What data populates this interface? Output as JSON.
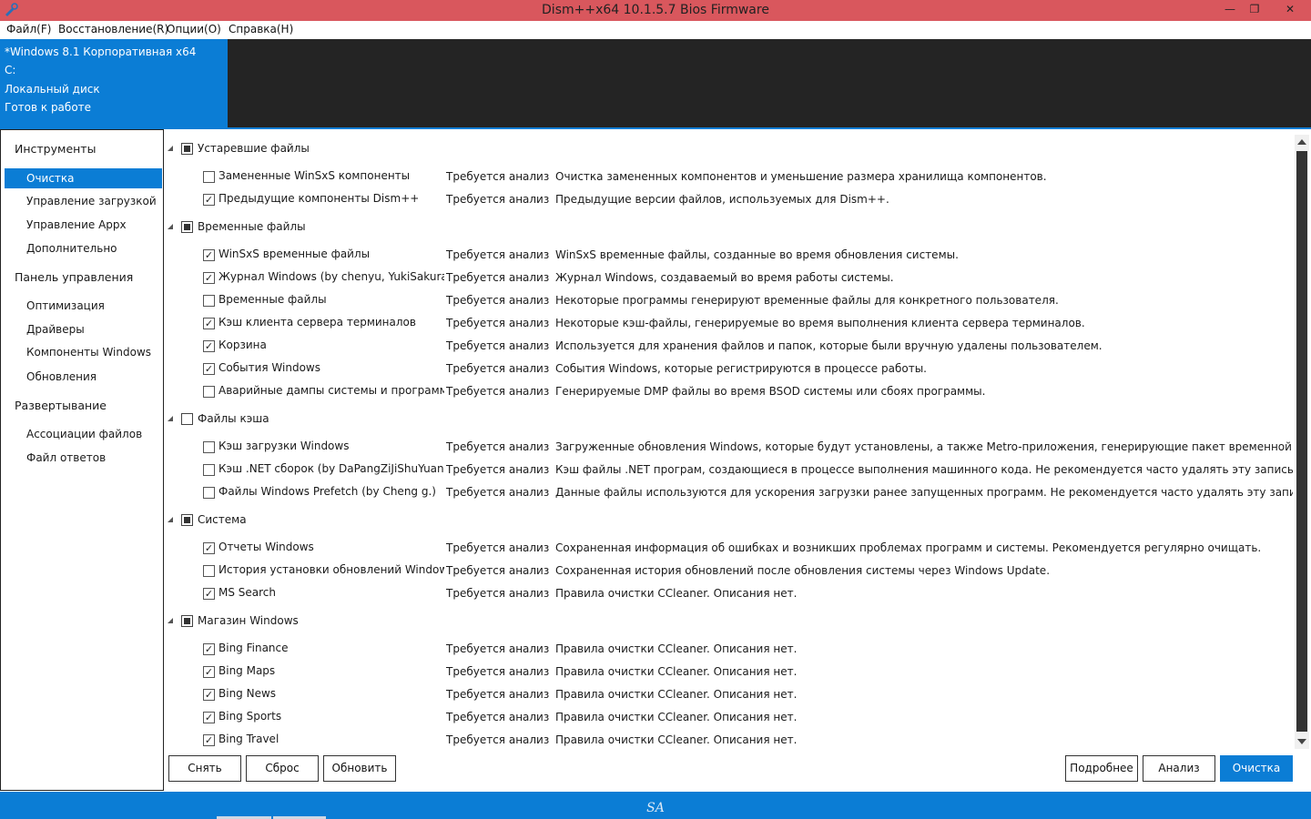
{
  "window": {
    "title": "Dism++x64 10.1.5.7 Bios Firmware",
    "minimize": "—",
    "maximize": "❐",
    "close": "✕"
  },
  "menu": [
    "Файл(F)",
    "Восстановление(R)",
    "Опции(O)",
    "Справка(H)"
  ],
  "info": {
    "os": "*Windows 8.1 Корпоративная x64",
    "drive": "C:",
    "disk": "Локальный диск",
    "state": "Готов к работе"
  },
  "sidebar": {
    "sections": [
      {
        "title": "Инструменты",
        "items": [
          "Очистка",
          "Управление загрузкой",
          "Управление Appx",
          "Дополнительно"
        ]
      },
      {
        "title": "Панель управления",
        "items": [
          "Оптимизация",
          "Драйверы",
          "Компоненты Windows",
          "Обновления"
        ]
      },
      {
        "title": "Развертывание",
        "items": [
          "Ассоциации файлов",
          "Файл ответов"
        ]
      }
    ],
    "active": "Очистка"
  },
  "groups": [
    {
      "label": "Устаревшие файлы",
      "state": "partial",
      "rows": [
        {
          "name": "Замененные WinSxS компоненты",
          "checked": false,
          "status": "Требуется анализ",
          "desc": "Очистка замененных компонентов и уменьшение размера хранилища компонентов."
        },
        {
          "name": "Предыдущие компоненты Dism++",
          "checked": true,
          "status": "Требуется анализ",
          "desc": "Предыдущие версии файлов, используемых для Dism++."
        }
      ]
    },
    {
      "label": "Временные файлы",
      "state": "partial",
      "rows": [
        {
          "name": "WinSxS временные файлы",
          "checked": true,
          "status": "Требуется анализ",
          "desc": "WinSxS временные файлы, созданные во время обновления системы."
        },
        {
          "name": "Журнал Windows (by chenyu, YukiSakura)",
          "checked": true,
          "status": "Требуется анализ",
          "desc": "Журнал Windows, создаваемый во время работы системы."
        },
        {
          "name": "Временные файлы",
          "checked": false,
          "status": "Требуется анализ",
          "desc": "Некоторые программы генерируют временные файлы для конкретного пользователя."
        },
        {
          "name": "Кэш клиента сервера терминалов",
          "checked": true,
          "status": "Требуется анализ",
          "desc": "Некоторые кэш-файлы, генерируемые во время выполнения клиента сервера терминалов."
        },
        {
          "name": "Корзина",
          "checked": true,
          "status": "Требуется анализ",
          "desc": "Используется для хранения файлов и папок, которые были вручную удалены пользователем."
        },
        {
          "name": "События Windows",
          "checked": true,
          "status": "Требуется анализ",
          "desc": "События Windows, которые регистрируются в процессе работы."
        },
        {
          "name": "Аварийные дампы системы и программ (b",
          "checked": false,
          "status": "Требуется анализ",
          "desc": "Генерируемые DMP файлы во время BSOD системы или сбоях программы."
        }
      ]
    },
    {
      "label": "Файлы кэша",
      "state": "unchecked",
      "rows": [
        {
          "name": "Кэш загрузки Windows",
          "checked": false,
          "status": "Требуется анализ",
          "desc": "Загруженные обновления Windows, которые будут установлены, а также Metro-приложения, генерирующие пакет временной установки"
        },
        {
          "name": "Кэш .NET сборок (by DaPangZiJiShuYuan)",
          "checked": false,
          "status": "Требуется анализ",
          "desc": "Кэш файлы .NET програм, создающиеся в процессе выполнения машинного кода. Не рекомендуется часто удалять эту запись."
        },
        {
          "name": "Файлы Windows Prefetch (by Cheng g.)",
          "checked": false,
          "status": "Требуется анализ",
          "desc": "Данные файлы используются для ускорения загрузки ранее запущенных программ. Не рекомендуется часто удалять эту запись."
        }
      ]
    },
    {
      "label": "Система",
      "state": "partial",
      "rows": [
        {
          "name": "Отчеты Windows",
          "checked": true,
          "status": "Требуется анализ",
          "desc": "Сохраненная информация об ошибках и возникших проблемах программ и системы. Рекомендуется регулярно очищать."
        },
        {
          "name": "История установки обновлений Windows",
          "checked": false,
          "status": "Требуется анализ",
          "desc": "Сохраненная история обновлений после обновления системы через Windows Update."
        },
        {
          "name": "MS Search",
          "checked": true,
          "status": "Требуется анализ",
          "desc": "Правила очистки CCleaner. Описания нет."
        }
      ]
    },
    {
      "label": "Магазин Windows",
      "state": "partial",
      "rows": [
        {
          "name": "Bing Finance",
          "checked": true,
          "status": "Требуется анализ",
          "desc": "Правила очистки CCleaner. Описания нет."
        },
        {
          "name": "Bing Maps",
          "checked": true,
          "status": "Требуется анализ",
          "desc": "Правила очистки CCleaner. Описания нет."
        },
        {
          "name": "Bing News",
          "checked": true,
          "status": "Требуется анализ",
          "desc": "Правила очистки CCleaner. Описания нет."
        },
        {
          "name": "Bing Sports",
          "checked": true,
          "status": "Требуется анализ",
          "desc": "Правила очистки CCleaner. Описания нет."
        },
        {
          "name": "Bing Travel",
          "checked": true,
          "status": "Требуется анализ",
          "desc": "Правила очистки CCleaner. Описания нет."
        }
      ]
    }
  ],
  "buttons": {
    "uncheck": "Снять",
    "reset": "Сброс",
    "refresh": "Обновить",
    "details": "Подробнее",
    "analyze": "Анализ",
    "clean": "Очистка"
  },
  "statusbar": {
    "logo": "SA"
  },
  "colors": {
    "accent": "#0b7dd5",
    "titlebar": "#d9575d",
    "dark_panel": "#242424"
  }
}
